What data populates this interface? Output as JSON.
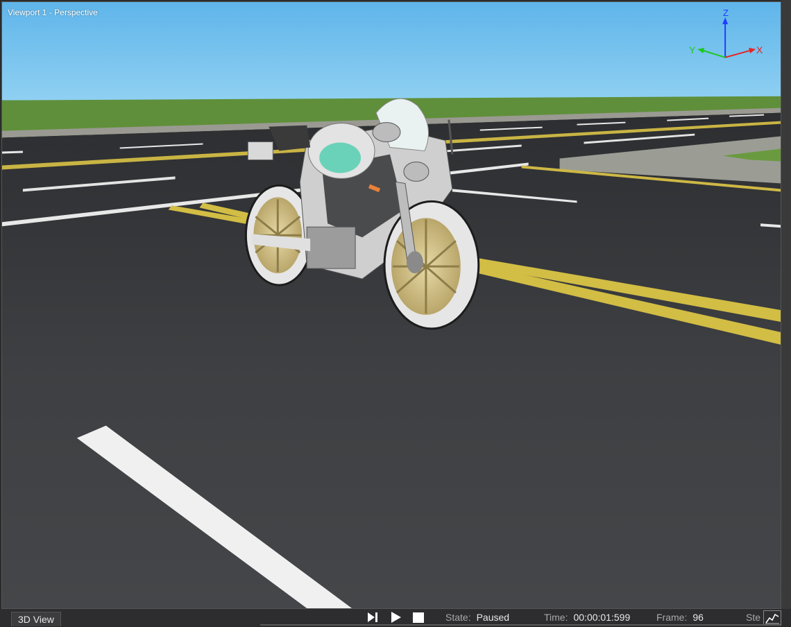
{
  "viewport": {
    "label": "Viewport 1 - Perspective",
    "axes": {
      "z": "Z",
      "y": "Y",
      "x": "X"
    }
  },
  "colors": {
    "sky": "#74c4ef",
    "grass": "#5f8f3a",
    "asphalt": "#3b3d40",
    "lane_yellow": "#d8c44a",
    "lane_white": "#f2f2f2",
    "axis_z": "#1e3cff",
    "axis_y": "#1ec81e",
    "axis_x": "#e82222"
  },
  "status_bar": {
    "tab_label": "3D View",
    "controls": [
      "step-forward-icon",
      "play-icon",
      "stop-icon"
    ],
    "state_label": "State:",
    "state_value": "Paused",
    "time_label": "Time:",
    "time_value": "00:00:01:599",
    "frame_label": "Frame:",
    "frame_value": "96",
    "step_label": "Ste",
    "graph_icon": "graph-icon"
  }
}
